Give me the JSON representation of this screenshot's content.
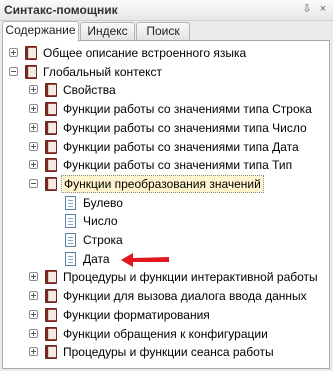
{
  "window": {
    "title": "Синтакс-помощник",
    "pin_glyph": "⇩",
    "close_glyph": "×"
  },
  "tabs": [
    {
      "label": "Содержание",
      "active": true
    },
    {
      "label": "Индекс",
      "active": false
    },
    {
      "label": "Поиск",
      "active": false
    }
  ],
  "tree": [
    {
      "label": "Общее описание встроенного языка",
      "icon": "book-icon",
      "expander": "plus"
    },
    {
      "label": "Глобальный контекст",
      "icon": "book-icon",
      "expander": "minus"
    },
    {
      "label": "Свойства",
      "icon": "book-icon",
      "expander": "plus"
    },
    {
      "label": "Функции работы со значениями типа Строка",
      "icon": "book-icon",
      "expander": "plus"
    },
    {
      "label": "Функции работы со значениями типа Число",
      "icon": "book-icon",
      "expander": "plus"
    },
    {
      "label": "Функции работы со значениями типа Дата",
      "icon": "book-icon",
      "expander": "plus"
    },
    {
      "label": "Функции работы со значениями типа Тип",
      "icon": "book-icon",
      "expander": "plus"
    },
    {
      "label": "Функции преобразования значений",
      "icon": "book-icon",
      "expander": "minus",
      "selected": true
    },
    {
      "label": "Булево",
      "icon": "document-icon"
    },
    {
      "label": "Число",
      "icon": "document-icon"
    },
    {
      "label": "Строка",
      "icon": "document-icon"
    },
    {
      "label": "Дата",
      "icon": "document-icon",
      "highlighted_by_arrow": true
    },
    {
      "label": "Процедуры и функции интерактивной работы",
      "icon": "book-icon",
      "expander": "plus"
    },
    {
      "label": "Функции для вызова диалога ввода данных",
      "icon": "book-icon",
      "expander": "plus"
    },
    {
      "label": "Функции форматирования",
      "icon": "book-icon",
      "expander": "plus"
    },
    {
      "label": "Функции обращения к конфигурации",
      "icon": "book-icon",
      "expander": "plus"
    },
    {
      "label": "Процедуры и функции сеанса работы",
      "icon": "book-icon",
      "expander": "plus"
    }
  ],
  "colors": {
    "selection_fill": "#fff6cf",
    "book": "#a44036",
    "arrow": "#e0171f"
  }
}
